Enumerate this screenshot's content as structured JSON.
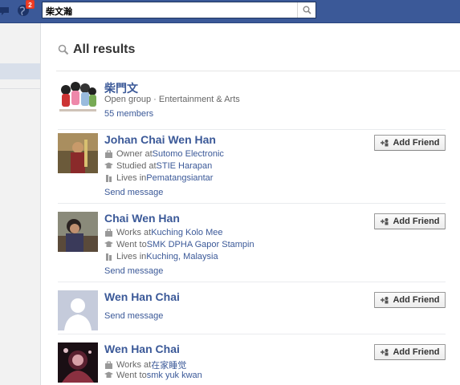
{
  "topbar": {
    "notification_count": "2",
    "search_query": "柴文瀚"
  },
  "heading": {
    "title": "All results"
  },
  "results": [
    {
      "name": "柴門文",
      "lines": [
        {
          "text": "Open group · Entertainment & Arts"
        }
      ],
      "members": "55 members"
    },
    {
      "name": "Johan Chai Wen Han",
      "lines": [
        {
          "prefix": "Owner at ",
          "link": "Sutomo Electronic",
          "icon": "work-icon"
        },
        {
          "prefix": "Studied at ",
          "link": "STIE Harapan",
          "icon": "education-icon"
        },
        {
          "prefix": "Lives in ",
          "link": "Pematangsiantar",
          "icon": "home-icon"
        }
      ],
      "message": "Send message",
      "button": "Add Friend"
    },
    {
      "name": "Chai Wen Han",
      "lines": [
        {
          "prefix": "Works at ",
          "link": "Kuching Kolo Mee",
          "icon": "work-icon"
        },
        {
          "prefix": "Went to ",
          "link": "SMK DPHA Gapor Stampin",
          "icon": "education-icon"
        },
        {
          "prefix": "Lives in ",
          "link": "Kuching, Malaysia",
          "icon": "home-icon"
        }
      ],
      "message": "Send message",
      "button": "Add Friend"
    },
    {
      "name": "Wen Han Chai",
      "lines": [],
      "message": "Send message",
      "button": "Add Friend"
    },
    {
      "name": "Wen Han Chai",
      "lines": [
        {
          "prefix": "Works at ",
          "link": "在家睡觉",
          "icon": "work-icon"
        },
        {
          "prefix": "Went to ",
          "link": "smk yuk kwan",
          "icon": "education-icon"
        }
      ],
      "button": "Add Friend"
    }
  ]
}
